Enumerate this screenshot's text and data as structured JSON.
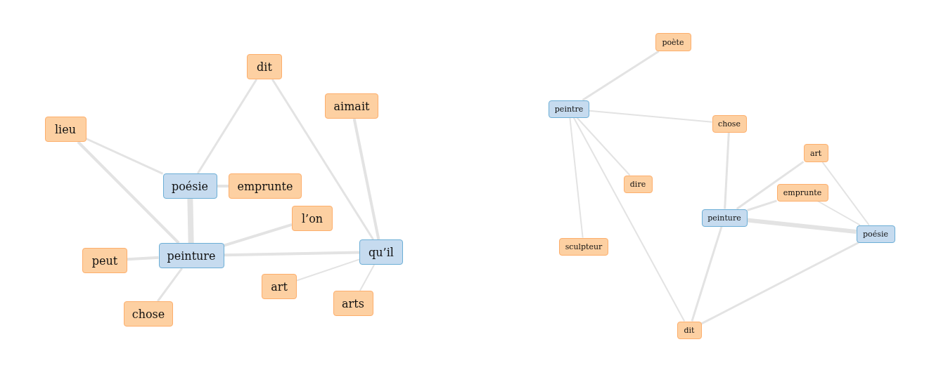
{
  "graphs": [
    {
      "nodes": [
        {
          "label": "dit",
          "kind": "term"
        },
        {
          "label": "aimait",
          "kind": "term"
        },
        {
          "label": "lieu",
          "kind": "term"
        },
        {
          "label": "poésie",
          "kind": "key"
        },
        {
          "label": "emprunte",
          "kind": "term"
        },
        {
          "label": "l’on",
          "kind": "term"
        },
        {
          "label": "peut",
          "kind": "term"
        },
        {
          "label": "peinture",
          "kind": "key"
        },
        {
          "label": "qu’il",
          "kind": "key"
        },
        {
          "label": "art",
          "kind": "term"
        },
        {
          "label": "arts",
          "kind": "term"
        },
        {
          "label": "chose",
          "kind": "term"
        }
      ]
    },
    {
      "nodes": [
        {
          "label": "poète",
          "kind": "term"
        },
        {
          "label": "peintre",
          "kind": "key"
        },
        {
          "label": "chose",
          "kind": "term"
        },
        {
          "label": "art",
          "kind": "term"
        },
        {
          "label": "dire",
          "kind": "term"
        },
        {
          "label": "emprunte",
          "kind": "term"
        },
        {
          "label": "peinture",
          "kind": "key"
        },
        {
          "label": "poésie",
          "kind": "key"
        },
        {
          "label": "sculpteur",
          "kind": "term"
        },
        {
          "label": "dit",
          "kind": "term"
        }
      ]
    }
  ]
}
